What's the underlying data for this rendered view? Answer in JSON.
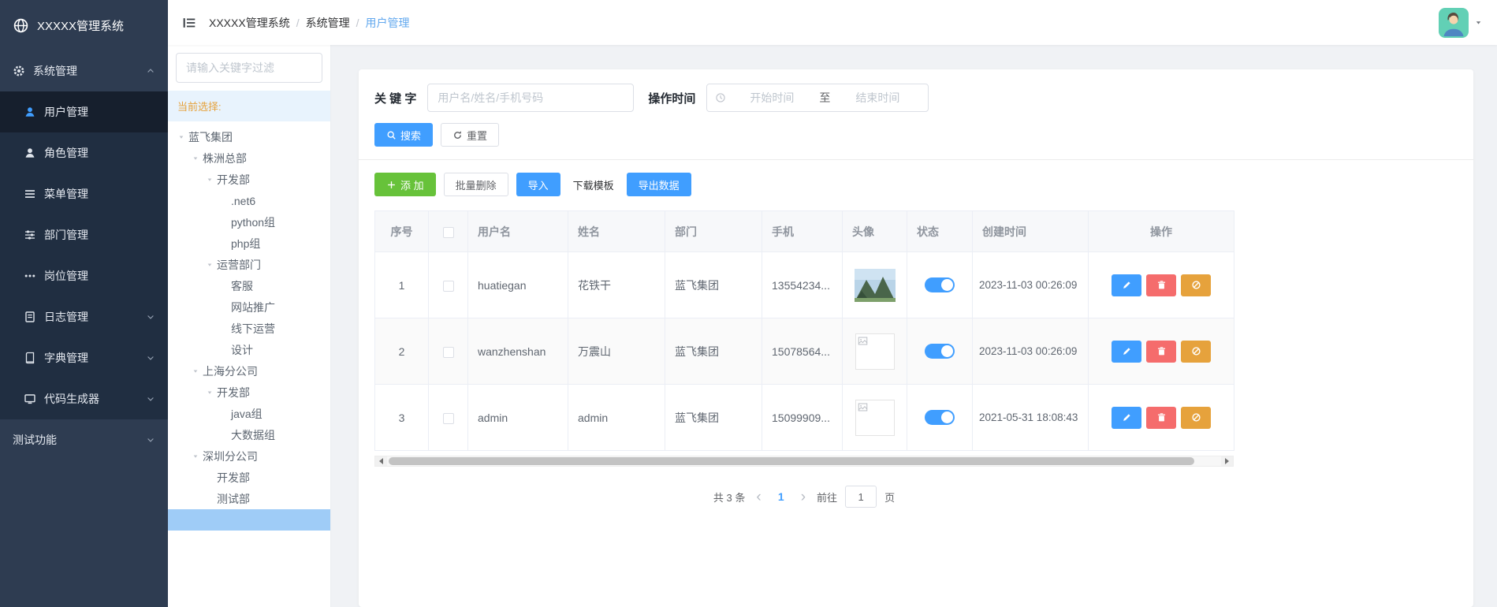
{
  "colors": {
    "primary": "#409EFF",
    "success": "#67C23A",
    "danger": "#F56C6C",
    "warning": "#E6A23C",
    "sidebar_bg": "#2E3C51",
    "submenu_bg": "#202E41"
  },
  "sidebar": {
    "logo": {
      "icon": "globe-icon",
      "title": "XXXXX管理系统"
    },
    "items": [
      {
        "label": "系统管理",
        "icon": "gear-icon",
        "expanded": true,
        "children": [
          {
            "label": "用户管理",
            "icon": "user-icon",
            "active": true
          },
          {
            "label": "角色管理",
            "icon": "user-icon"
          },
          {
            "label": "菜单管理",
            "icon": "menu-list-icon"
          },
          {
            "label": "部门管理",
            "icon": "sliders-icon"
          },
          {
            "label": "岗位管理",
            "icon": "dots-icon"
          },
          {
            "label": "日志管理",
            "icon": "document-icon",
            "has_children": true
          },
          {
            "label": "字典管理",
            "icon": "book-icon",
            "has_children": true
          },
          {
            "label": "代码生成器",
            "icon": "monitor-icon",
            "has_children": true
          }
        ]
      },
      {
        "label": "测试功能",
        "has_children": true
      }
    ]
  },
  "header": {
    "breadcrumb": [
      "XXXXX管理系统",
      "系统管理",
      "用户管理"
    ],
    "separator": "/"
  },
  "tree_panel": {
    "filter_placeholder": "请输入关键字过滤",
    "current_selection_label": "当前选择:",
    "nodes": [
      {
        "label": "蓝飞集团",
        "level": 0,
        "expanded": true
      },
      {
        "label": "株洲总部",
        "level": 1,
        "expanded": true
      },
      {
        "label": "开发部",
        "level": 2,
        "expanded": true
      },
      {
        "label": ".net6",
        "level": 3
      },
      {
        "label": "python组",
        "level": 3
      },
      {
        "label": "php组",
        "level": 3
      },
      {
        "label": "运营部门",
        "level": 2,
        "expanded": true
      },
      {
        "label": "客服",
        "level": 3
      },
      {
        "label": "网站推广",
        "level": 3
      },
      {
        "label": "线下运营",
        "level": 3
      },
      {
        "label": "设计",
        "level": 3
      },
      {
        "label": "上海分公司",
        "level": 1,
        "expanded": true
      },
      {
        "label": "开发部",
        "level": 2,
        "expanded": true
      },
      {
        "label": "java组",
        "level": 3
      },
      {
        "label": "大数据组",
        "level": 3
      },
      {
        "label": "深圳分公司",
        "level": 1,
        "expanded": true
      },
      {
        "label": "开发部",
        "level": 2
      },
      {
        "label": "测试部",
        "level": 2
      }
    ]
  },
  "filters": {
    "keyword_label": "关 键 字",
    "keyword_placeholder": "用户名/姓名/手机号码",
    "time_label": "操作时间",
    "start_placeholder": "开始时间",
    "range_separator": "至",
    "end_placeholder": "结束时间",
    "search_label": "搜索",
    "reset_label": "重置"
  },
  "toolbar": {
    "add_label": "添 加",
    "batch_delete_label": "批量删除",
    "import_label": "导入",
    "download_template_label": "下载模板",
    "export_label": "导出数据"
  },
  "table": {
    "headers": [
      "序号",
      "",
      "用户名",
      "姓名",
      "部门",
      "手机",
      "头像",
      "状态",
      "创建时间",
      "操作"
    ],
    "rows": [
      {
        "index": "1",
        "username": "huatiegan",
        "name": "花铁干",
        "department": "蓝飞集团",
        "phone": "13554234...",
        "avatar": "photo",
        "status_on": true,
        "created_at": "2023-11-03 00:26:09"
      },
      {
        "index": "2",
        "username": "wanzhenshan",
        "name": "万震山",
        "department": "蓝飞集团",
        "phone": "15078564...",
        "avatar": "broken",
        "status_on": true,
        "created_at": "2023-11-03 00:26:09"
      },
      {
        "index": "3",
        "username": "admin",
        "name": "admin",
        "department": "蓝飞集团",
        "phone": "15099909...",
        "avatar": "broken",
        "status_on": true,
        "created_at": "2021-05-31 18:08:43"
      }
    ]
  },
  "pagination": {
    "total_label": "共 3 条",
    "current_page": "1",
    "goto_label": "前往",
    "goto_value": "1",
    "page_unit_label": "页"
  }
}
